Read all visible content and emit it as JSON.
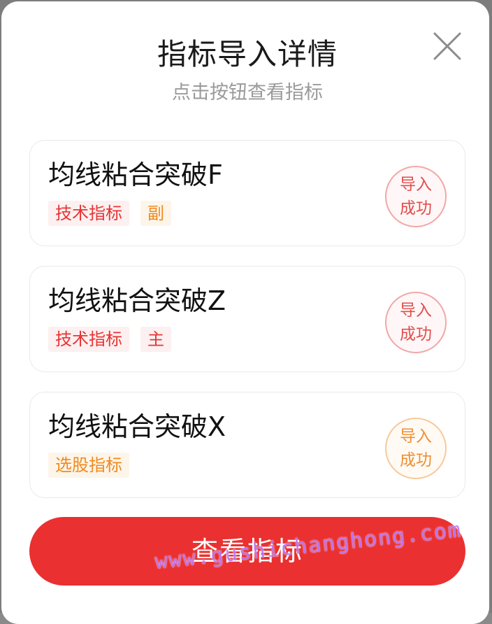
{
  "dialog": {
    "title": "指标导入详情",
    "subtitle": "点击按钮查看指标",
    "close_icon": "close-icon"
  },
  "cards": [
    {
      "name": "均线粘合突破F",
      "tags": [
        {
          "label": "技术指标",
          "color": "#e63535"
        },
        {
          "label": "副",
          "color": "#f08a1e"
        }
      ],
      "status": {
        "line1": "导入",
        "line2": "成功",
        "color": "#e24d4d"
      }
    },
    {
      "name": "均线粘合突破Z",
      "tags": [
        {
          "label": "技术指标",
          "color": "#e63535"
        },
        {
          "label": "主",
          "color": "#e63535"
        }
      ],
      "status": {
        "line1": "导入",
        "line2": "成功",
        "color": "#e24d4d"
      }
    },
    {
      "name": "均线粘合突破X",
      "tags": [
        {
          "label": "选股指标",
          "color": "#f08a1e"
        }
      ],
      "status": {
        "line1": "导入",
        "line2": "成功",
        "color": "#ee8f33"
      }
    }
  ],
  "primary_button": {
    "label": "查看指标",
    "color": "#ea3030"
  },
  "watermark": "www.gushichanghong.com"
}
